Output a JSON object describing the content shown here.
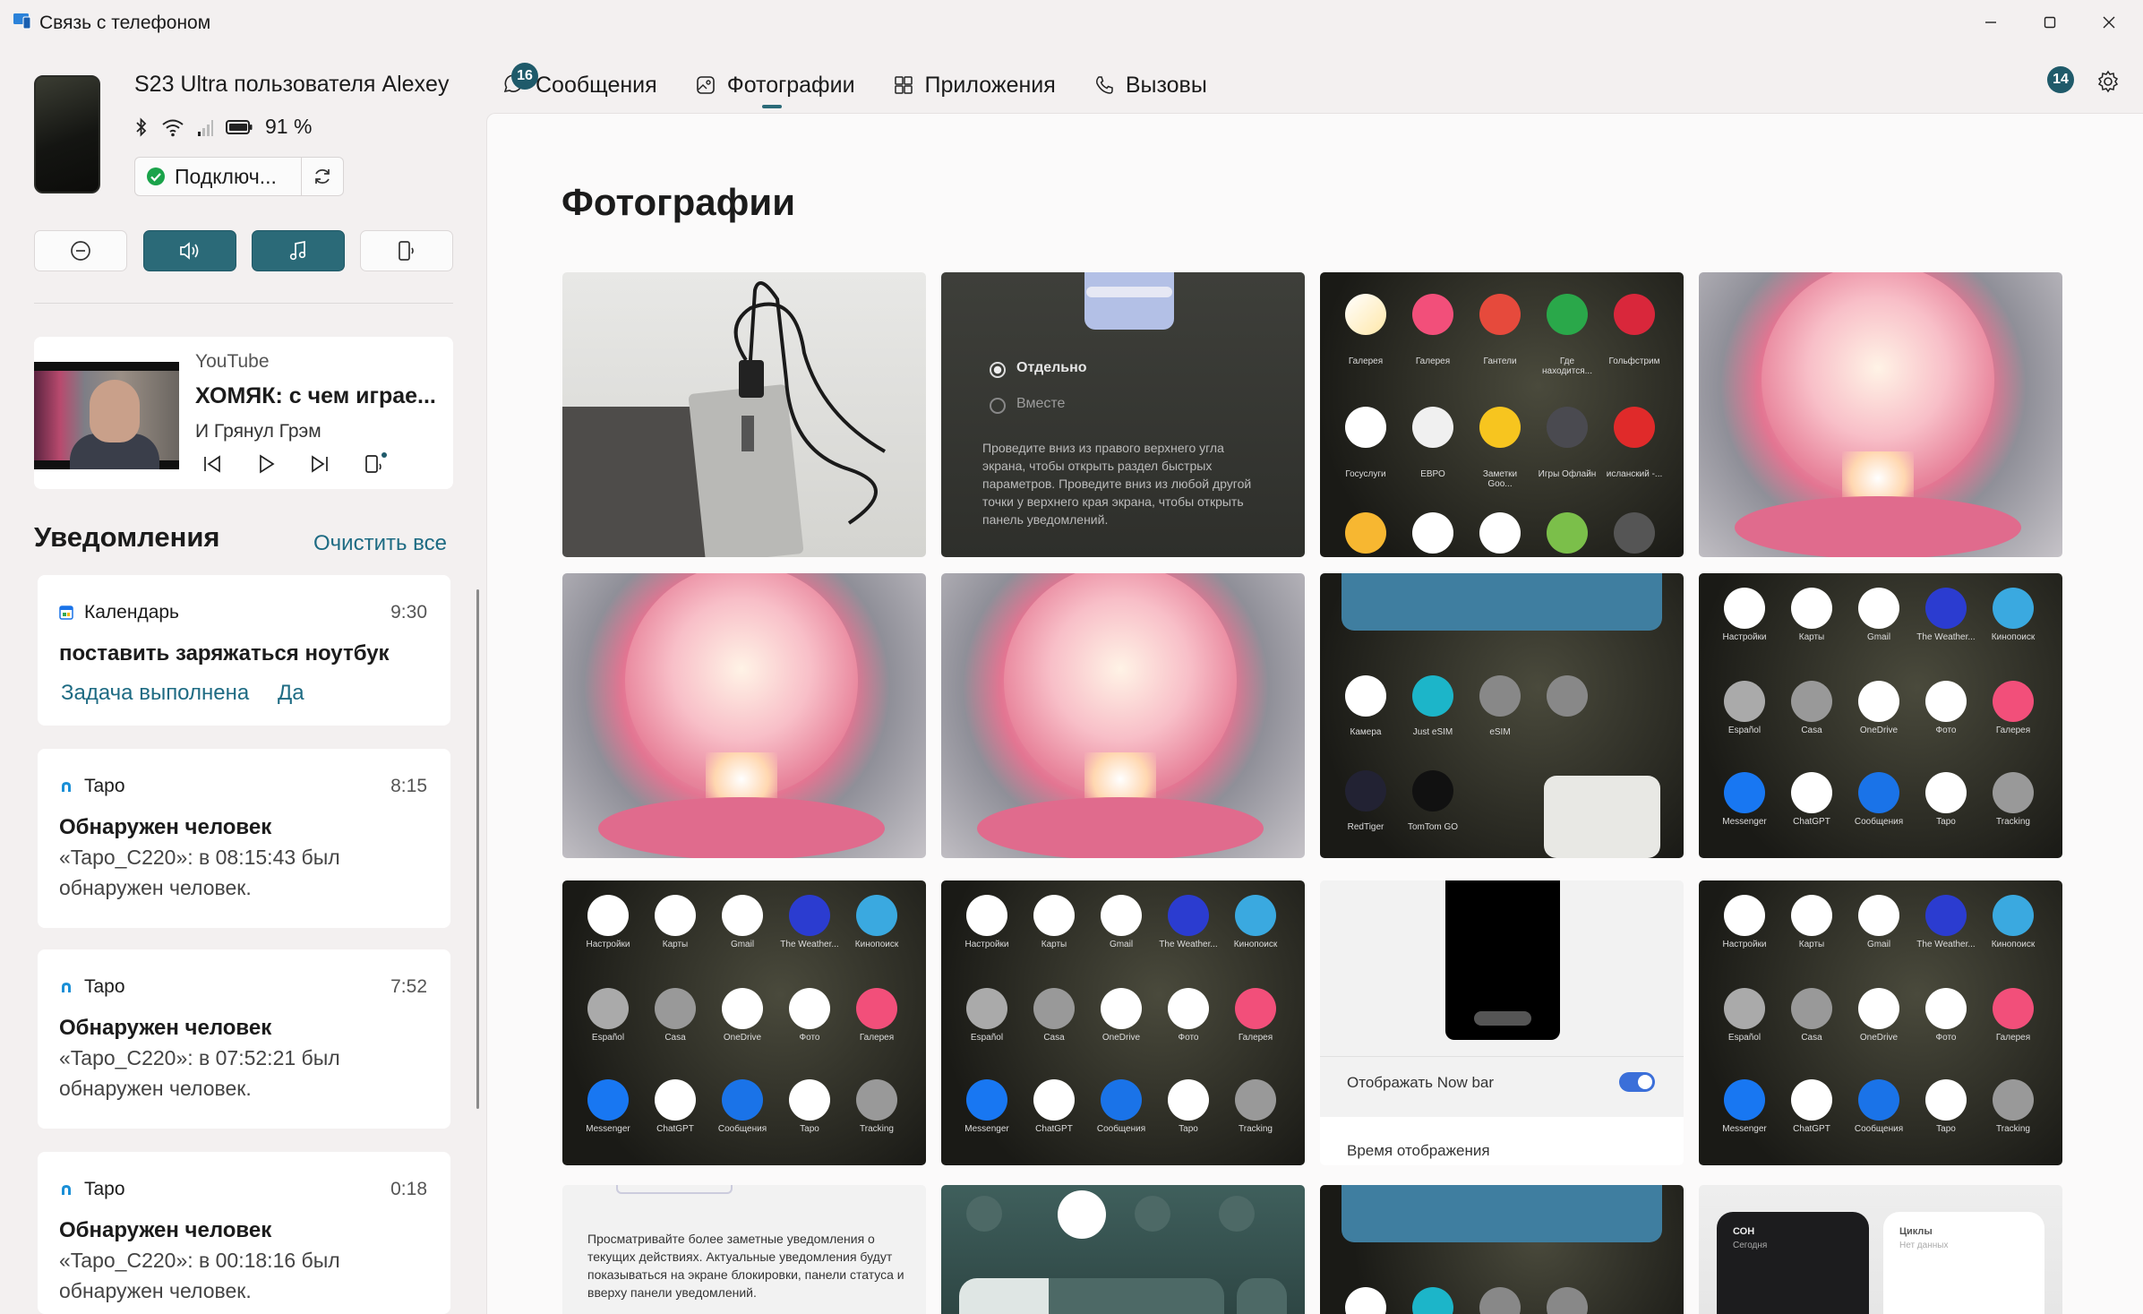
{
  "window": {
    "title": "Связь с телефоном"
  },
  "device": {
    "name": "S23 Ultra пользователя Alexey",
    "battery": "91 %",
    "connection_status": "Подключ..."
  },
  "media": {
    "app": "YouTube",
    "title": "ХОМЯК: с чем играе...",
    "artist": "И Грянул Грэм"
  },
  "notifications": {
    "heading": "Уведомления",
    "clear_all": "Очистить все",
    "items": [
      {
        "app": "Календарь",
        "time": "9:30",
        "title": "поставить заряжаться ноутбук",
        "action1": "Задача выполнена",
        "action2": "Да"
      },
      {
        "app": "Tapo",
        "time": "8:15",
        "title": "Обнаружен человек",
        "body": "«Tapo_C220»: в 08:15:43 был обнаружен человек."
      },
      {
        "app": "Tapo",
        "time": "7:52",
        "title": "Обнаружен человек",
        "body": "«Tapo_C220»: в 07:52:21 был обнаружен человек."
      },
      {
        "app": "Tapo",
        "time": "0:18",
        "title": "Обнаружен человек",
        "body": "«Tapo_C220»: в 00:18:16 был обнаружен человек."
      }
    ]
  },
  "tabs": [
    {
      "label": "Сообщения",
      "badge": "16"
    },
    {
      "label": "Фотографии",
      "selected": true
    },
    {
      "label": "Приложения"
    },
    {
      "label": "Вызовы"
    }
  ],
  "header_badge": "14",
  "page": {
    "title": "Фотографии"
  },
  "photos": {
    "tile2": {
      "option1": "Отдельно",
      "option2": "Вместе",
      "text": "Проведите вниз из правого верхнего угла экрана, чтобы открыть раздел быстрых параметров. Проведите вниз из любой другой точки у верхнего края экрана, чтобы открыть панель уведомлений."
    },
    "tile3_labels": [
      "Галерея",
      "Галерея",
      "Гантели",
      "Где находится...",
      "Гольфстрим",
      "Госуслуги",
      "ЕВРО",
      "Заметки Goo...",
      "Игры Офлайн",
      "исланский -..."
    ],
    "app_grid_labels": [
      "Настройки",
      "Карты",
      "Gmail",
      "The Weather...",
      "Кинопоиск",
      "Español",
      "Casa",
      "OneDrive",
      "Фото",
      "Галерея",
      "Messenger",
      "ChatGPT",
      "Сообщения",
      "Tapo",
      "Tracking"
    ],
    "tile7_labels": [
      "Камера",
      "Just eSIM",
      "eSIM",
      "RedTiger",
      "TomTom GO"
    ],
    "tile11": {
      "toggle_label": "Отображать Now bar",
      "time_label": "Время отображения"
    },
    "tile13_text": "Просматривайте более заметные уведомления о текущих действиях. Актуальные уведомления будут показываться на экране блокировки, панели статуса и вверху панели уведомлений.",
    "tile16": {
      "card1_title": "СОН",
      "card1_sub": "Сегодня",
      "card2_title": "Циклы",
      "card2_sub": "Нет данных"
    }
  },
  "colors": {
    "accent": "#2b6a78",
    "link": "#1e6b83",
    "badge": "#1f5a6a",
    "connected_green": "#1aa34a"
  }
}
